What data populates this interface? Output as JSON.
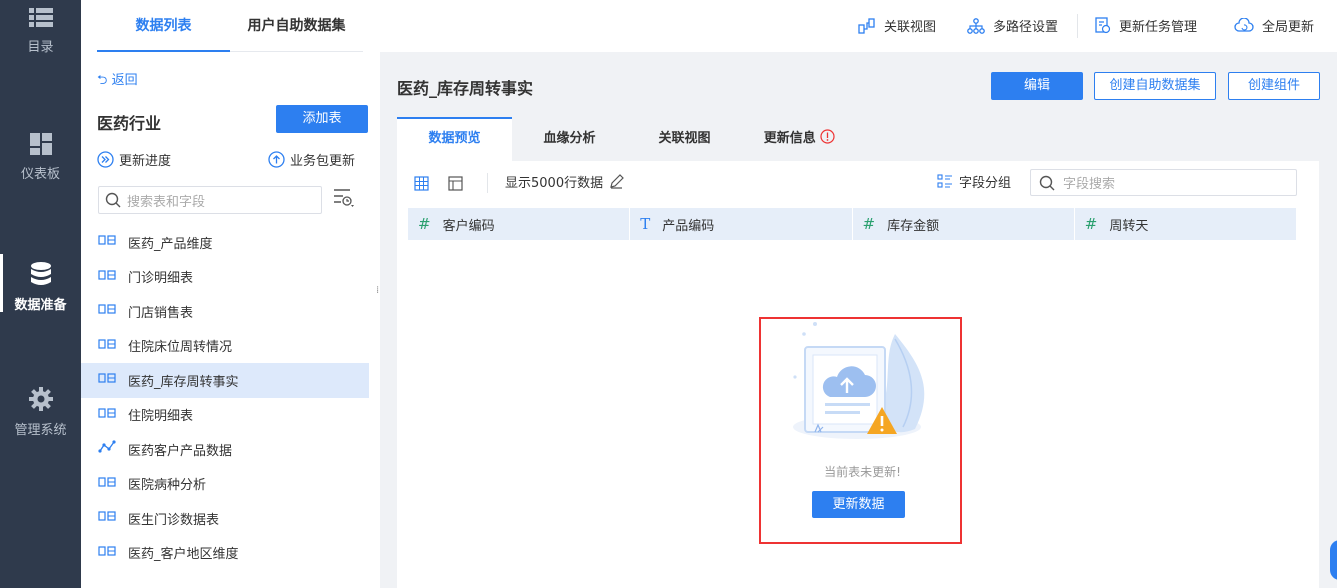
{
  "rail": {
    "items": [
      {
        "label": "目录",
        "icon": "list-icon"
      },
      {
        "label": "仪表板",
        "icon": "dashboard-icon"
      },
      {
        "label": "数据准备",
        "icon": "database-icon"
      },
      {
        "label": "管理系统",
        "icon": "gear-icon"
      }
    ]
  },
  "left_panel": {
    "tabs": [
      "数据列表",
      "用户自助数据集"
    ],
    "back": "返回",
    "title": "医药行业",
    "add_button": "添加表",
    "progress": "更新进度",
    "package_update": "业务包更新",
    "search_placeholder": "搜索表和字段",
    "tables": [
      {
        "name": "医药_产品维度",
        "type": "db"
      },
      {
        "name": "门诊明细表",
        "type": "db"
      },
      {
        "name": "门店销售表",
        "type": "db"
      },
      {
        "name": "住院床位周转情况",
        "type": "db"
      },
      {
        "name": "医药_库存周转事实",
        "type": "db",
        "selected": true
      },
      {
        "name": "住院明细表",
        "type": "db"
      },
      {
        "name": "医药客户产品数据",
        "type": "etl"
      },
      {
        "name": "医院病种分析",
        "type": "db"
      },
      {
        "name": "医生门诊数据表",
        "type": "db"
      },
      {
        "name": "医药_客户地区维度",
        "type": "db"
      }
    ]
  },
  "topbar": {
    "actions": [
      "关联视图",
      "多路径设置",
      "更新任务管理",
      "全局更新"
    ]
  },
  "main": {
    "title": "医药_库存周转事实",
    "buttons": {
      "edit": "编辑",
      "create_dataset": "创建自助数据集",
      "create_component": "创建组件"
    },
    "tabs": [
      "数据预览",
      "血缘分析",
      "关联视图",
      "更新信息"
    ],
    "toolbar": {
      "rows_label": "显示5000行数据",
      "field_group": "字段分组",
      "field_search_placeholder": "字段搜索"
    },
    "columns": [
      {
        "type": "#",
        "name": "客户编码"
      },
      {
        "type": "T",
        "name": "产品编码"
      },
      {
        "type": "#",
        "name": "库存金额"
      },
      {
        "type": "#",
        "name": "周转天"
      }
    ],
    "empty": {
      "message": "当前表未更新!",
      "button": "更新数据"
    }
  }
}
